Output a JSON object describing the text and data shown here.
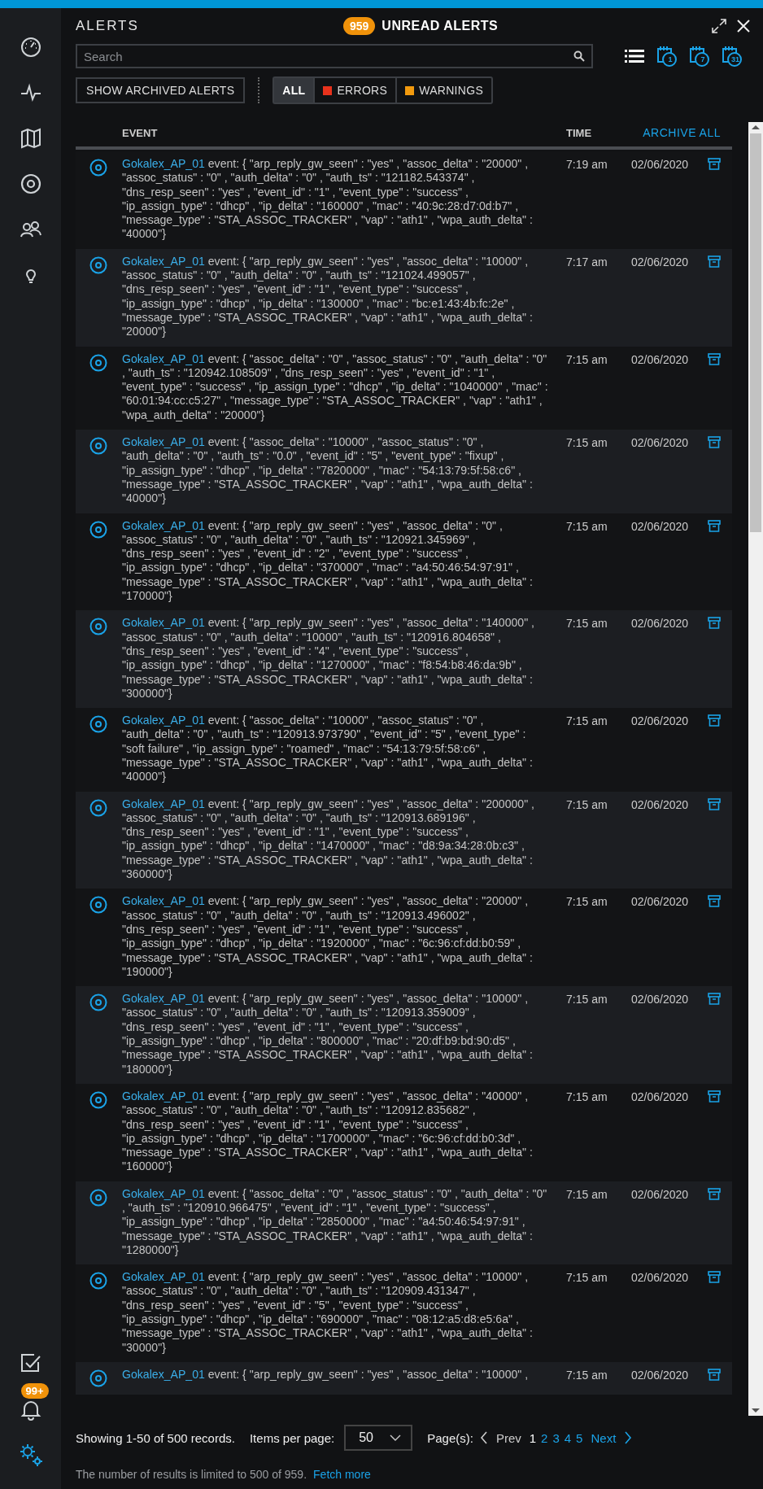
{
  "sidebar": {
    "items": [
      {
        "selected": false
      },
      {
        "selected": false
      },
      {
        "selected": false
      },
      {
        "selected": false
      },
      {
        "selected": false
      },
      {
        "selected": false
      }
    ],
    "bottom_items": [
      {
        "selected": false
      },
      {
        "selected": false,
        "badge": "99+"
      },
      {
        "selected": true
      }
    ]
  },
  "header": {
    "title": "ALERTS",
    "unread_count": "959",
    "unread_label": "UNREAD ALERTS"
  },
  "search": {
    "placeholder": "Search"
  },
  "view_buttons": [
    {
      "kind": "list"
    },
    {
      "kind": "calendar",
      "label": "1"
    },
    {
      "kind": "calendar",
      "label": "7"
    },
    {
      "kind": "calendar",
      "label": "31"
    }
  ],
  "archived_button": "SHOW ARCHIVED ALERTS",
  "filters": [
    {
      "label": "ALL",
      "selected": true
    },
    {
      "label": "ERRORS",
      "selected": false,
      "color": "#e8321c"
    },
    {
      "label": "WARNINGS",
      "selected": false,
      "color": "#f29a0e"
    }
  ],
  "table": {
    "columns": [
      "EVENT",
      "TIME"
    ],
    "archive_all": "ARCHIVE ALL",
    "rows": [
      {
        "source": "Gokalex_AP_01",
        "message": "event: { \"arp_reply_gw_seen\" : \"yes\" , \"assoc_delta\" : \"20000\" , \"assoc_status\" : \"0\" , \"auth_delta\" : \"0\" , \"auth_ts\" : \"121182.543374\" , \"dns_resp_seen\" : \"yes\" , \"event_id\" : \"1\" , \"event_type\" : \"success\" , \"ip_assign_type\" : \"dhcp\" , \"ip_delta\" : \"160000\" , \"mac\" : \"40:9c:28:d7:0d:b7\" , \"message_type\" : \"STA_ASSOC_TRACKER\" , \"vap\" : \"ath1\" , \"wpa_auth_delta\" : \"40000\"}",
        "time": "7:19 am",
        "date": "02/06/2020"
      },
      {
        "source": "Gokalex_AP_01",
        "message": "event: { \"arp_reply_gw_seen\" : \"yes\" , \"assoc_delta\" : \"10000\" , \"assoc_status\" : \"0\" , \"auth_delta\" : \"0\" , \"auth_ts\" : \"121024.499057\" , \"dns_resp_seen\" : \"yes\" , \"event_id\" : \"1\" , \"event_type\" : \"success\" , \"ip_assign_type\" : \"dhcp\" , \"ip_delta\" : \"130000\" , \"mac\" : \"bc:e1:43:4b:fc:2e\" , \"message_type\" : \"STA_ASSOC_TRACKER\" , \"vap\" : \"ath1\" , \"wpa_auth_delta\" : \"20000\"}",
        "time": "7:17 am",
        "date": "02/06/2020"
      },
      {
        "source": "Gokalex_AP_01",
        "message": "event: { \"assoc_delta\" : \"0\" , \"assoc_status\" : \"0\" , \"auth_delta\" : \"0\" , \"auth_ts\" : \"120942.108509\" , \"dns_resp_seen\" : \"yes\" , \"event_id\" : \"1\" , \"event_type\" : \"success\" , \"ip_assign_type\" : \"dhcp\" , \"ip_delta\" : \"1040000\" , \"mac\" : \"60:01:94:cc:c5:27\" , \"message_type\" : \"STA_ASSOC_TRACKER\" , \"vap\" : \"ath1\" , \"wpa_auth_delta\" : \"20000\"}",
        "time": "7:15 am",
        "date": "02/06/2020"
      },
      {
        "source": "Gokalex_AP_01",
        "message": "event: { \"assoc_delta\" : \"10000\" , \"assoc_status\" : \"0\" , \"auth_delta\" : \"0\" , \"auth_ts\" : \"0.0\" , \"event_id\" : \"5\" , \"event_type\" : \"fixup\" , \"ip_assign_type\" : \"dhcp\" , \"ip_delta\" : \"7820000\" , \"mac\" : \"54:13:79:5f:58:c6\" , \"message_type\" : \"STA_ASSOC_TRACKER\" , \"vap\" : \"ath1\" , \"wpa_auth_delta\" : \"40000\"}",
        "time": "7:15 am",
        "date": "02/06/2020"
      },
      {
        "source": "Gokalex_AP_01",
        "message": "event: { \"arp_reply_gw_seen\" : \"yes\" , \"assoc_delta\" : \"0\" , \"assoc_status\" : \"0\" , \"auth_delta\" : \"0\" , \"auth_ts\" : \"120921.345969\" , \"dns_resp_seen\" : \"yes\" , \"event_id\" : \"2\" , \"event_type\" : \"success\" , \"ip_assign_type\" : \"dhcp\" , \"ip_delta\" : \"370000\" , \"mac\" : \"a4:50:46:54:97:91\" , \"message_type\" : \"STA_ASSOC_TRACKER\" , \"vap\" : \"ath1\" , \"wpa_auth_delta\" : \"170000\"}",
        "time": "7:15 am",
        "date": "02/06/2020"
      },
      {
        "source": "Gokalex_AP_01",
        "message": "event: { \"arp_reply_gw_seen\" : \"yes\" , \"assoc_delta\" : \"140000\" , \"assoc_status\" : \"0\" , \"auth_delta\" : \"10000\" , \"auth_ts\" : \"120916.804658\" , \"dns_resp_seen\" : \"yes\" , \"event_id\" : \"4\" , \"event_type\" : \"success\" , \"ip_assign_type\" : \"dhcp\" , \"ip_delta\" : \"1270000\" , \"mac\" : \"f8:54:b8:46:da:9b\" , \"message_type\" : \"STA_ASSOC_TRACKER\" , \"vap\" : \"ath1\" , \"wpa_auth_delta\" : \"300000\"}",
        "time": "7:15 am",
        "date": "02/06/2020"
      },
      {
        "source": "Gokalex_AP_01",
        "message": "event: { \"assoc_delta\" : \"10000\" , \"assoc_status\" : \"0\" , \"auth_delta\" : \"0\" , \"auth_ts\" : \"120913.973790\" , \"event_id\" : \"5\" , \"event_type\" : \"soft failure\" , \"ip_assign_type\" : \"roamed\" , \"mac\" : \"54:13:79:5f:58:c6\" , \"message_type\" : \"STA_ASSOC_TRACKER\" , \"vap\" : \"ath1\" , \"wpa_auth_delta\" : \"40000\"}",
        "time": "7:15 am",
        "date": "02/06/2020"
      },
      {
        "source": "Gokalex_AP_01",
        "message": "event: { \"arp_reply_gw_seen\" : \"yes\" , \"assoc_delta\" : \"200000\" , \"assoc_status\" : \"0\" , \"auth_delta\" : \"0\" , \"auth_ts\" : \"120913.689196\" , \"dns_resp_seen\" : \"yes\" , \"event_id\" : \"1\" , \"event_type\" : \"success\" , \"ip_assign_type\" : \"dhcp\" , \"ip_delta\" : \"1470000\" , \"mac\" : \"d8:9a:34:28:0b:c3\" , \"message_type\" : \"STA_ASSOC_TRACKER\" , \"vap\" : \"ath1\" , \"wpa_auth_delta\" : \"360000\"}",
        "time": "7:15 am",
        "date": "02/06/2020"
      },
      {
        "source": "Gokalex_AP_01",
        "message": "event: { \"arp_reply_gw_seen\" : \"yes\" , \"assoc_delta\" : \"20000\" , \"assoc_status\" : \"0\" , \"auth_delta\" : \"0\" , \"auth_ts\" : \"120913.496002\" , \"dns_resp_seen\" : \"yes\" , \"event_id\" : \"1\" , \"event_type\" : \"success\" , \"ip_assign_type\" : \"dhcp\" , \"ip_delta\" : \"1920000\" , \"mac\" : \"6c:96:cf:dd:b0:59\" , \"message_type\" : \"STA_ASSOC_TRACKER\" , \"vap\" : \"ath1\" , \"wpa_auth_delta\" : \"190000\"}",
        "time": "7:15 am",
        "date": "02/06/2020"
      },
      {
        "source": "Gokalex_AP_01",
        "message": "event: { \"arp_reply_gw_seen\" : \"yes\" , \"assoc_delta\" : \"10000\" , \"assoc_status\" : \"0\" , \"auth_delta\" : \"0\" , \"auth_ts\" : \"120913.359009\" , \"dns_resp_seen\" : \"yes\" , \"event_id\" : \"1\" , \"event_type\" : \"success\" , \"ip_assign_type\" : \"dhcp\" , \"ip_delta\" : \"800000\" , \"mac\" : \"20:df:b9:bd:90:d5\" , \"message_type\" : \"STA_ASSOC_TRACKER\" , \"vap\" : \"ath1\" , \"wpa_auth_delta\" : \"180000\"}",
        "time": "7:15 am",
        "date": "02/06/2020"
      },
      {
        "source": "Gokalex_AP_01",
        "message": "event: { \"arp_reply_gw_seen\" : \"yes\" , \"assoc_delta\" : \"40000\" , \"assoc_status\" : \"0\" , \"auth_delta\" : \"0\" , \"auth_ts\" : \"120912.835682\" , \"dns_resp_seen\" : \"yes\" , \"event_id\" : \"1\" , \"event_type\" : \"success\" , \"ip_assign_type\" : \"dhcp\" , \"ip_delta\" : \"1700000\" , \"mac\" : \"6c:96:cf:dd:b0:3d\" , \"message_type\" : \"STA_ASSOC_TRACKER\" , \"vap\" : \"ath1\" , \"wpa_auth_delta\" : \"160000\"}",
        "time": "7:15 am",
        "date": "02/06/2020"
      },
      {
        "source": "Gokalex_AP_01",
        "message": "event: { \"assoc_delta\" : \"0\" , \"assoc_status\" : \"0\" , \"auth_delta\" : \"0\" , \"auth_ts\" : \"120910.966475\" , \"event_id\" : \"1\" , \"event_type\" : \"success\" , \"ip_assign_type\" : \"dhcp\" , \"ip_delta\" : \"2850000\" , \"mac\" : \"a4:50:46:54:97:91\" , \"message_type\" : \"STA_ASSOC_TRACKER\" , \"vap\" : \"ath1\" , \"wpa_auth_delta\" : \"1280000\"}",
        "time": "7:15 am",
        "date": "02/06/2020"
      },
      {
        "source": "Gokalex_AP_01",
        "message": "event: { \"arp_reply_gw_seen\" : \"yes\" , \"assoc_delta\" : \"10000\" , \"assoc_status\" : \"0\" , \"auth_delta\" : \"0\" , \"auth_ts\" : \"120909.431347\" , \"dns_resp_seen\" : \"yes\" , \"event_id\" : \"5\" , \"event_type\" : \"success\" , \"ip_assign_type\" : \"dhcp\" , \"ip_delta\" : \"690000\" , \"mac\" : \"08:12:a5:d8:e5:6a\" , \"message_type\" : \"STA_ASSOC_TRACKER\" , \"vap\" : \"ath1\" , \"wpa_auth_delta\" : \"30000\"}",
        "time": "7:15 am",
        "date": "02/06/2020"
      },
      {
        "source": "Gokalex_AP_01",
        "message": "event: { \"arp_reply_gw_seen\" : \"yes\" , \"assoc_delta\" : \"10000\" ,",
        "time": "7:15 am",
        "date": "02/06/2020"
      }
    ]
  },
  "footer": {
    "summary": "Showing 1-50 of 500 records.",
    "items_label": "Items per page:",
    "items_value": "50",
    "pages_label": "Page(s):",
    "prev": {
      "label": "Prev",
      "disabled": true
    },
    "pages": [
      {
        "label": "1",
        "selected": true
      },
      {
        "label": "2",
        "selected": false
      },
      {
        "label": "3",
        "selected": false
      },
      {
        "label": "4",
        "selected": false
      },
      {
        "label": "5",
        "selected": false
      }
    ],
    "next": {
      "label": "Next",
      "disabled": false
    },
    "note": "The number of results is limited to 500 of 959.",
    "fetch_more": "Fetch more"
  }
}
